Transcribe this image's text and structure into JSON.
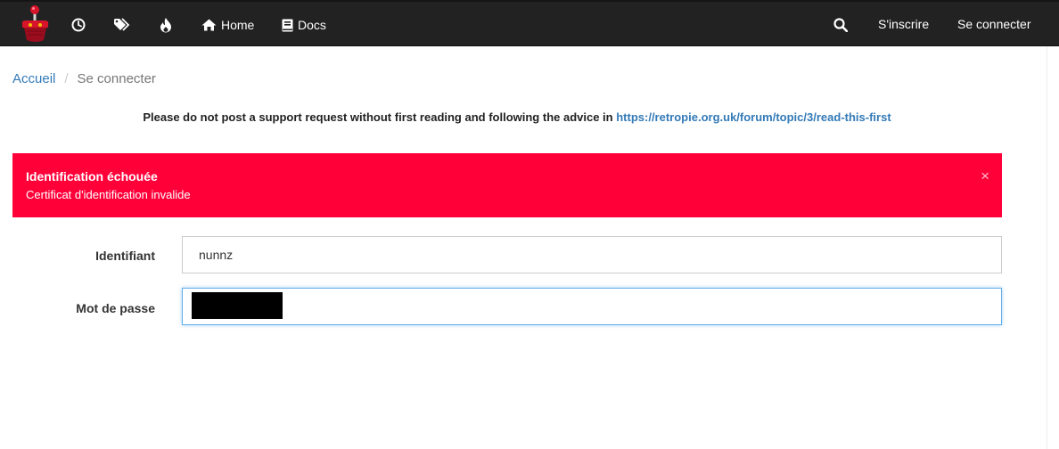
{
  "navbar": {
    "items": {
      "recent": "recent-icon",
      "tags": "tags-icon",
      "popular": "fire-icon"
    },
    "home_label": "Home",
    "docs_label": "Docs",
    "register_label": "S'inscrire",
    "login_label": "Se connecter"
  },
  "breadcrumb": {
    "home": "Accueil",
    "separator": "/",
    "current": "Se connecter"
  },
  "notice": {
    "text": "Please do not post a support request without first reading and following the advice in ",
    "link": "https://retropie.org.uk/forum/topic/3/read-this-first"
  },
  "alert": {
    "title": "Identification échouée",
    "message": "Certificat d'identification invalide",
    "close": "×",
    "color": "#ff0039"
  },
  "form": {
    "username_label": "Identifiant",
    "username_value": "nunnz",
    "password_label": "Mot de passe"
  },
  "colors": {
    "navbar": "#222222",
    "link": "#337ab7",
    "focus": "#66afe9"
  }
}
